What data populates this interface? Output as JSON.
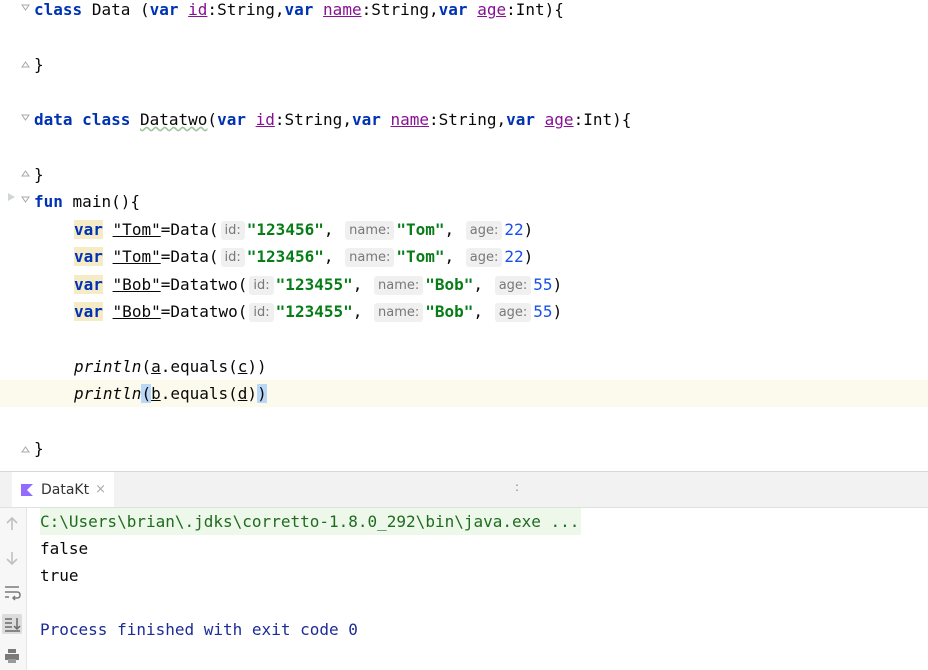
{
  "editor": {
    "lines": [
      {
        "t": "class Data (var id:String,var name:String,var age:Int){"
      },
      {
        "t": ""
      },
      {
        "t": "}"
      },
      {
        "t": ""
      },
      {
        "t": "data class Datatwo(var id:String,var name:String,var age:Int){"
      },
      {
        "t": ""
      },
      {
        "t": "}"
      },
      {
        "t": "fun main(){"
      }
    ],
    "class_data": {
      "kw": "class",
      "name": "Data",
      "open": " (",
      "var": "var",
      "p1": "id",
      "p2": "name",
      "p3": "age",
      "type_str": "String",
      "type_int": "Int",
      "close": "){"
    },
    "class_datatwo": {
      "kw1": "data",
      "kw2": "class",
      "name": "Datatwo",
      "open": "(",
      "close": "){"
    },
    "brace_close": "}",
    "fun_line": {
      "kw": "fun",
      "rest": "main(){"
    },
    "vars": [
      {
        "kw": "var",
        "name": "\"Tom\"",
        "ctor": "Data(",
        "hint_id": "id:",
        "id": "\"123456\"",
        "hint_name": "name:",
        "hint_age": "age:",
        "age": "22"
      },
      {
        "kw": "var",
        "name": "\"Tom\"",
        "ctor": "Data(",
        "hint_id": "id:",
        "id": "\"123456\"",
        "hint_name": "name:",
        "hint_age": "age:",
        "age": "22"
      },
      {
        "kw": "var",
        "name": "\"Bob\"",
        "ctor": "Datatwo(",
        "hint_id": "id:",
        "id": "\"123455\"",
        "hint_name": "name:",
        "hint_age": "age:",
        "age": "55"
      },
      {
        "kw": "var",
        "name": "\"Bob\"",
        "ctor": "Datatwo(",
        "hint_id": "id:",
        "id": "\"123455\"",
        "hint_name": "name:",
        "hint_age": "age:",
        "age": "55"
      }
    ],
    "print1": {
      "fn": "println",
      "a": "a",
      "method": ".equals(",
      "b": "c",
      "close": "))"
    },
    "print2": {
      "fn": "println",
      "a": "b",
      "method": ".equals(",
      "b": "d",
      "close": ")"
    },
    "end_brace": "}"
  },
  "run": {
    "tab_label": "DataKt",
    "close_glyph": "×",
    "command": "C:\\Users\\brian\\.jdks\\corretto-1.8.0_292\\bin\\java.exe ...",
    "output": [
      "false",
      "true"
    ],
    "exit": "Process finished with exit code 0"
  },
  "colors": {
    "keyword": "#0033b3",
    "property": "#871094",
    "string": "#067d17",
    "number": "#1750eb",
    "current_line": "#fcfaed"
  }
}
